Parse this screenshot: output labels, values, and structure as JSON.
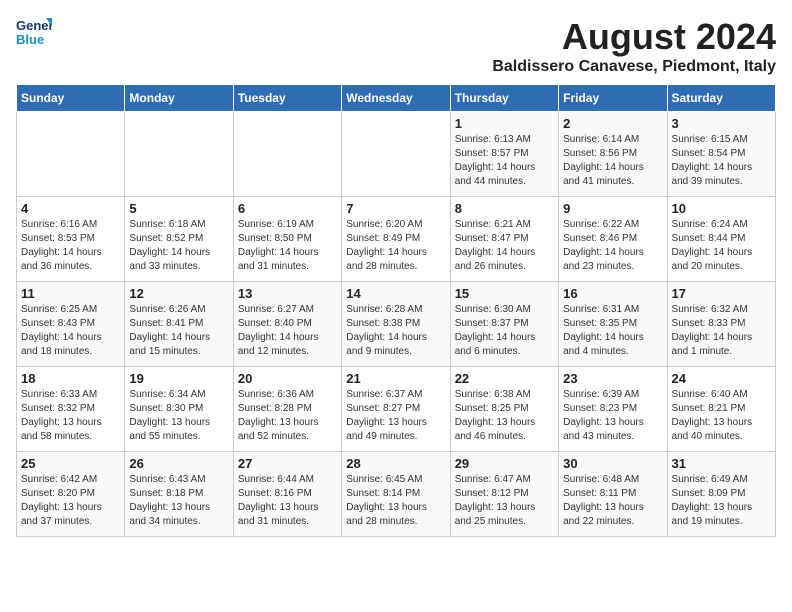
{
  "header": {
    "logo_line1": "General",
    "logo_line2": "Blue",
    "month_title": "August 2024",
    "location": "Baldissero Canavese, Piedmont, Italy"
  },
  "weekdays": [
    "Sunday",
    "Monday",
    "Tuesday",
    "Wednesday",
    "Thursday",
    "Friday",
    "Saturday"
  ],
  "weeks": [
    [
      {
        "day": "",
        "content": ""
      },
      {
        "day": "",
        "content": ""
      },
      {
        "day": "",
        "content": ""
      },
      {
        "day": "",
        "content": ""
      },
      {
        "day": "1",
        "content": "Sunrise: 6:13 AM\nSunset: 8:57 PM\nDaylight: 14 hours and 44 minutes."
      },
      {
        "day": "2",
        "content": "Sunrise: 6:14 AM\nSunset: 8:56 PM\nDaylight: 14 hours and 41 minutes."
      },
      {
        "day": "3",
        "content": "Sunrise: 6:15 AM\nSunset: 8:54 PM\nDaylight: 14 hours and 39 minutes."
      }
    ],
    [
      {
        "day": "4",
        "content": "Sunrise: 6:16 AM\nSunset: 8:53 PM\nDaylight: 14 hours and 36 minutes."
      },
      {
        "day": "5",
        "content": "Sunrise: 6:18 AM\nSunset: 8:52 PM\nDaylight: 14 hours and 33 minutes."
      },
      {
        "day": "6",
        "content": "Sunrise: 6:19 AM\nSunset: 8:50 PM\nDaylight: 14 hours and 31 minutes."
      },
      {
        "day": "7",
        "content": "Sunrise: 6:20 AM\nSunset: 8:49 PM\nDaylight: 14 hours and 28 minutes."
      },
      {
        "day": "8",
        "content": "Sunrise: 6:21 AM\nSunset: 8:47 PM\nDaylight: 14 hours and 26 minutes."
      },
      {
        "day": "9",
        "content": "Sunrise: 6:22 AM\nSunset: 8:46 PM\nDaylight: 14 hours and 23 minutes."
      },
      {
        "day": "10",
        "content": "Sunrise: 6:24 AM\nSunset: 8:44 PM\nDaylight: 14 hours and 20 minutes."
      }
    ],
    [
      {
        "day": "11",
        "content": "Sunrise: 6:25 AM\nSunset: 8:43 PM\nDaylight: 14 hours and 18 minutes."
      },
      {
        "day": "12",
        "content": "Sunrise: 6:26 AM\nSunset: 8:41 PM\nDaylight: 14 hours and 15 minutes."
      },
      {
        "day": "13",
        "content": "Sunrise: 6:27 AM\nSunset: 8:40 PM\nDaylight: 14 hours and 12 minutes."
      },
      {
        "day": "14",
        "content": "Sunrise: 6:28 AM\nSunset: 8:38 PM\nDaylight: 14 hours and 9 minutes."
      },
      {
        "day": "15",
        "content": "Sunrise: 6:30 AM\nSunset: 8:37 PM\nDaylight: 14 hours and 6 minutes."
      },
      {
        "day": "16",
        "content": "Sunrise: 6:31 AM\nSunset: 8:35 PM\nDaylight: 14 hours and 4 minutes."
      },
      {
        "day": "17",
        "content": "Sunrise: 6:32 AM\nSunset: 8:33 PM\nDaylight: 14 hours and 1 minute."
      }
    ],
    [
      {
        "day": "18",
        "content": "Sunrise: 6:33 AM\nSunset: 8:32 PM\nDaylight: 13 hours and 58 minutes."
      },
      {
        "day": "19",
        "content": "Sunrise: 6:34 AM\nSunset: 8:30 PM\nDaylight: 13 hours and 55 minutes."
      },
      {
        "day": "20",
        "content": "Sunrise: 6:36 AM\nSunset: 8:28 PM\nDaylight: 13 hours and 52 minutes."
      },
      {
        "day": "21",
        "content": "Sunrise: 6:37 AM\nSunset: 8:27 PM\nDaylight: 13 hours and 49 minutes."
      },
      {
        "day": "22",
        "content": "Sunrise: 6:38 AM\nSunset: 8:25 PM\nDaylight: 13 hours and 46 minutes."
      },
      {
        "day": "23",
        "content": "Sunrise: 6:39 AM\nSunset: 8:23 PM\nDaylight: 13 hours and 43 minutes."
      },
      {
        "day": "24",
        "content": "Sunrise: 6:40 AM\nSunset: 8:21 PM\nDaylight: 13 hours and 40 minutes."
      }
    ],
    [
      {
        "day": "25",
        "content": "Sunrise: 6:42 AM\nSunset: 8:20 PM\nDaylight: 13 hours and 37 minutes."
      },
      {
        "day": "26",
        "content": "Sunrise: 6:43 AM\nSunset: 8:18 PM\nDaylight: 13 hours and 34 minutes."
      },
      {
        "day": "27",
        "content": "Sunrise: 6:44 AM\nSunset: 8:16 PM\nDaylight: 13 hours and 31 minutes."
      },
      {
        "day": "28",
        "content": "Sunrise: 6:45 AM\nSunset: 8:14 PM\nDaylight: 13 hours and 28 minutes."
      },
      {
        "day": "29",
        "content": "Sunrise: 6:47 AM\nSunset: 8:12 PM\nDaylight: 13 hours and 25 minutes."
      },
      {
        "day": "30",
        "content": "Sunrise: 6:48 AM\nSunset: 8:11 PM\nDaylight: 13 hours and 22 minutes."
      },
      {
        "day": "31",
        "content": "Sunrise: 6:49 AM\nSunset: 8:09 PM\nDaylight: 13 hours and 19 minutes."
      }
    ]
  ]
}
